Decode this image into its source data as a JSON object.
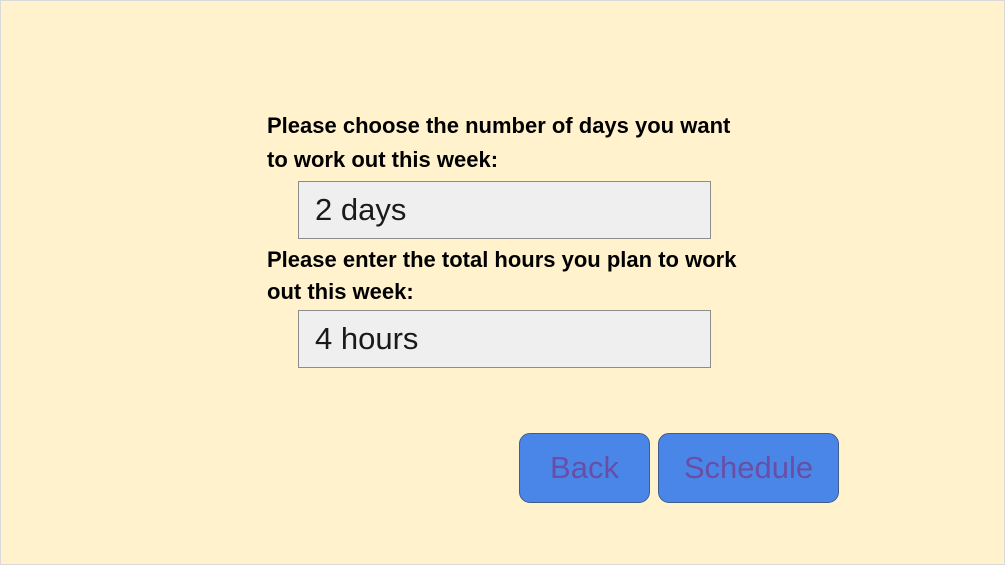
{
  "form": {
    "days_question": "Please choose the number of days you want to work out this week:",
    "days_value": "2 days",
    "hours_question": "Please enter the total hours you plan to work out this week:",
    "hours_value": "4 hours"
  },
  "buttons": {
    "back_label": "Back",
    "schedule_label": "Schedule"
  },
  "colors": {
    "background": "#fff2cc",
    "button_fill": "#4a86e8",
    "button_text": "#6a4ea6",
    "field_fill": "#efefef"
  }
}
